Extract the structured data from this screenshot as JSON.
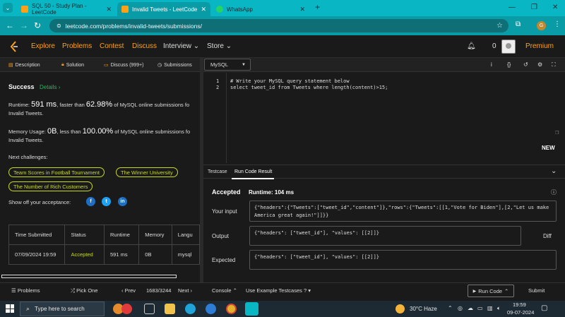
{
  "browser": {
    "tabs": [
      {
        "title": "SQL 50 - Study Plan - LeetCode"
      },
      {
        "title": "Invalid Tweets - LeetCode"
      },
      {
        "title": "WhatsApp"
      }
    ],
    "new_tab": "+",
    "url": "leetcode.com/problems/invalid-tweets/submissions/",
    "profile_letter": "G"
  },
  "nav": {
    "explore": "Explore",
    "problems": "Problems",
    "contest": "Contest",
    "discuss": "Discuss",
    "interview": "Interview",
    "store": "Store",
    "coins": "0",
    "premium": "Premium"
  },
  "left_tabs": {
    "description": "Description",
    "solution": "Solution",
    "discuss": "Discuss (999+)",
    "submissions": "Submissions"
  },
  "result": {
    "status": "Success",
    "details": "Details",
    "details_arrow": "›",
    "runtime_label": "Runtime: ",
    "runtime_value": "591 ms",
    "runtime_mid": ", faster than ",
    "runtime_pct": "62.98%",
    "runtime_tail": " of MySQL online submissions fo",
    "runtime_tail2": "Invalid Tweets.",
    "memory_label": "Memory Usage: ",
    "memory_value": "0B",
    "memory_mid": ", less than ",
    "memory_pct": "100.00%",
    "memory_tail": " of MySQL online submissions fo",
    "memory_tail2": "Invalid Tweets.",
    "next_challenges": "Next challenges:",
    "challenges": [
      "Team Scores in Football Tournament",
      "The Winner University",
      "The Number of Rich Customers"
    ],
    "share": "Show off your acceptance:",
    "social_letters": [
      "f",
      "t",
      "in"
    ]
  },
  "submissions_table": {
    "headers": [
      "Time Submitted",
      "Status",
      "Runtime",
      "Memory",
      "Langu"
    ],
    "rows": [
      [
        "07/09/2024 19:59",
        "Accepted",
        "591 ms",
        "0B",
        "mysql"
      ]
    ]
  },
  "editor": {
    "language": "MySQL",
    "lines": [
      {
        "n": "1",
        "code": "# Write your MySQL query statement below"
      },
      {
        "n": "2",
        "code": "select tweet_id from Tweets where length(content)>15;"
      }
    ],
    "new_badge": "NEW"
  },
  "console": {
    "tab_testcase": "Testcase",
    "tab_result": "Run Code Result",
    "accepted": "Accepted",
    "runtime": "Runtime: 104 ms",
    "your_input_label": "Your input",
    "your_input": "{\"headers\":{\"Tweets\":[\"tweet_id\",\"content\"]},\"rows\":{\"Tweets\":[[1,\"Vote for Biden\"],[2,\"Let us make America great again!\"]]}}",
    "output_label": "Output",
    "output": "{\"headers\": [\"tweet_id\"], \"values\": [[2]]}",
    "diff": "Diff",
    "expected_label": "Expected",
    "expected": "{\"headers\": [\"tweet_id\"], \"values\": [[2]]}"
  },
  "bottom": {
    "problems": "Problems",
    "pick_one": "Pick One",
    "prev": "Prev",
    "page": "1683/3244",
    "next": "Next",
    "console": "Console",
    "use_example": "Use Example Testcases",
    "run_code": "Run Code",
    "submit": "Submit"
  },
  "taskbar": {
    "search_placeholder": "Type here to search",
    "weather": "30°C  Haze",
    "time": "19:59",
    "date": "09-07-2024"
  },
  "colors": {
    "accent": "#ffa116",
    "success": "#2db55d",
    "chrome": "#08b6c4",
    "pill": "#c9d820"
  }
}
